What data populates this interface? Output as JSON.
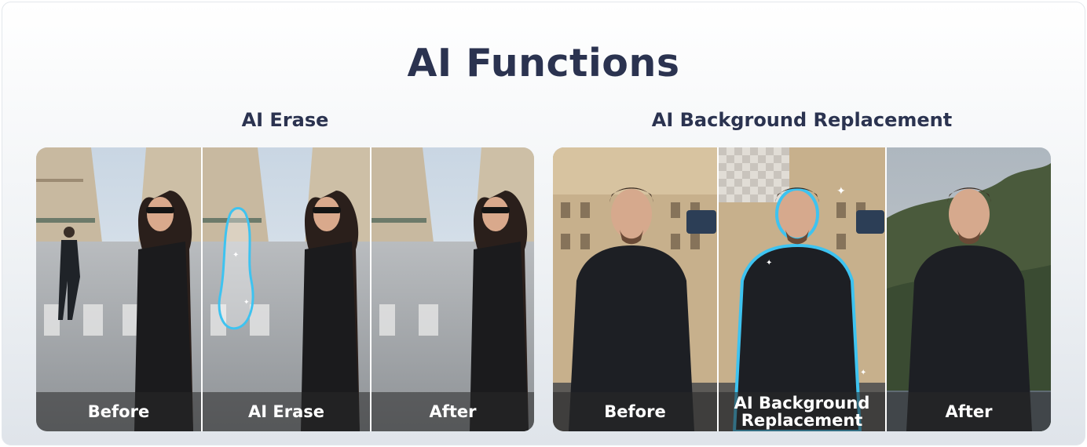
{
  "page": {
    "title": "AI Functions"
  },
  "sections": {
    "erase": {
      "title": "AI Erase",
      "frames": [
        "Before",
        "AI Erase",
        "After"
      ]
    },
    "bg": {
      "title": "AI Background Replacement",
      "frames": [
        "Before",
        "AI Background",
        "Replacement",
        "After"
      ]
    }
  },
  "colors": {
    "title": "#2b3350",
    "outline": "#3ec3f0"
  }
}
